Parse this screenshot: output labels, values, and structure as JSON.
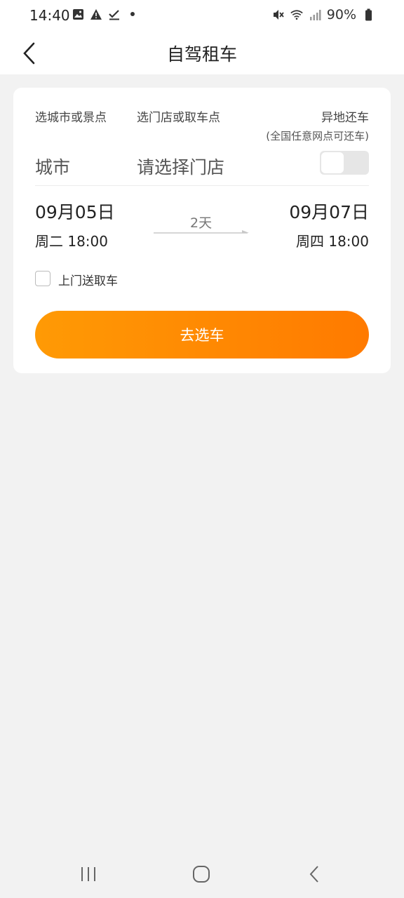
{
  "status_bar": {
    "time": "14:40",
    "battery": "90%",
    "icons_left": [
      "image-icon",
      "warning-icon",
      "check-icon",
      "dot-icon"
    ],
    "icons_right": [
      "mute-icon",
      "wifi-icon",
      "signal-icon",
      "battery-icon"
    ]
  },
  "header": {
    "title": "自驾租车"
  },
  "form": {
    "city_label": "选城市或景点",
    "store_label": "选门店或取车点",
    "return_label": "异地还车",
    "return_note": "(全国任意网点可还车)",
    "city_value": "城市",
    "store_placeholder": "请选择门店",
    "return_toggle_on": false,
    "pickup_date": "09月05日",
    "pickup_time": "周二 18:00",
    "duration": "2天",
    "return_date": "09月07日",
    "return_time": "周四 18:00",
    "delivery_label": "上门送取车",
    "delivery_checked": false,
    "submit_label": "去选车"
  },
  "colors": {
    "accent_start": "#ff9a05",
    "accent_end": "#ff7a00",
    "background": "#f2f2f2"
  }
}
